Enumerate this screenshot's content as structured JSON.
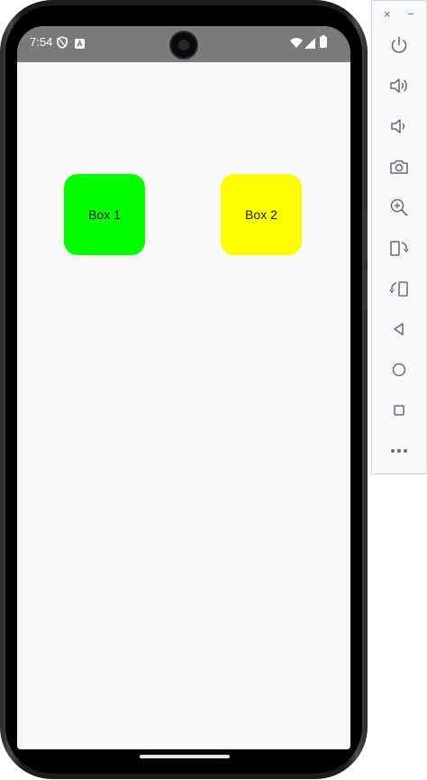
{
  "status_bar": {
    "time": "7:54",
    "icons": [
      "shield-icon",
      "app-notification-icon",
      "wifi-icon",
      "signal-icon",
      "battery-icon"
    ]
  },
  "boxes": [
    {
      "label": "Box 1",
      "color": "#00ff00"
    },
    {
      "label": "Box 2",
      "color": "#ffff00"
    }
  ],
  "toolbar": {
    "close": "×",
    "minimize": "−",
    "buttons": [
      "power",
      "volume-up",
      "volume-down",
      "screenshot",
      "zoom",
      "rotate-left",
      "rotate-right",
      "back",
      "home",
      "overview",
      "more"
    ]
  }
}
